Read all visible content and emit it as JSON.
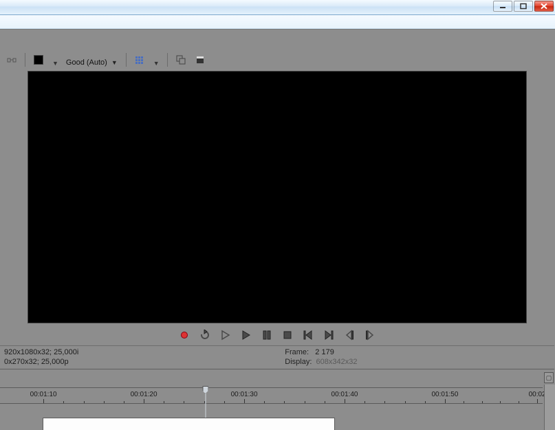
{
  "toolbar": {
    "quality_label": "Good (Auto)"
  },
  "transport": {},
  "status": {
    "project_fmt_line1": "920x1080x32; 25,000i",
    "project_fmt_line2": "0x270x32; 25,000p",
    "frame_label": "Frame:",
    "frame_value": "2 179",
    "display_label": "Display:",
    "display_value": "608x342x32"
  },
  "timeline": {
    "ticks": [
      "00:01:10",
      "00:01:20",
      "00:01:30",
      "00:01:40",
      "00:01:50",
      "00:02"
    ],
    "playhead_pct": 37.0,
    "clip_title": ""
  }
}
